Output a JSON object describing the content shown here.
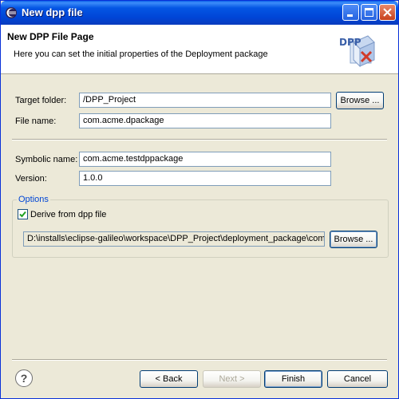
{
  "window": {
    "title": "New dpp file"
  },
  "header": {
    "title": "New DPP File Page",
    "description": "Here you can set the initial properties of the Deployment package",
    "logo_text": "DPP"
  },
  "form": {
    "target_folder": {
      "label": "Target folder:",
      "value": "/DPP_Project",
      "browse": "Browse ..."
    },
    "file_name": {
      "label": "File name:",
      "value": "com.acme.dpackage"
    },
    "symbolic_name": {
      "label": "Symbolic name:",
      "value": "com.acme.testdppackage"
    },
    "version": {
      "label": "Version:",
      "value": "1.0.0"
    }
  },
  "options": {
    "group_title": "Options",
    "derive_checkbox": {
      "label": "Derive from dpp file",
      "checked": true
    },
    "dpp_path": {
      "value": "D:\\installs\\eclipse-galileo\\workspace\\DPP_Project\\deployment_package\\com.",
      "browse": "Browse ..."
    }
  },
  "footer": {
    "help": "?",
    "back": "< Back",
    "next": "Next >",
    "finish": "Finish",
    "cancel": "Cancel"
  }
}
